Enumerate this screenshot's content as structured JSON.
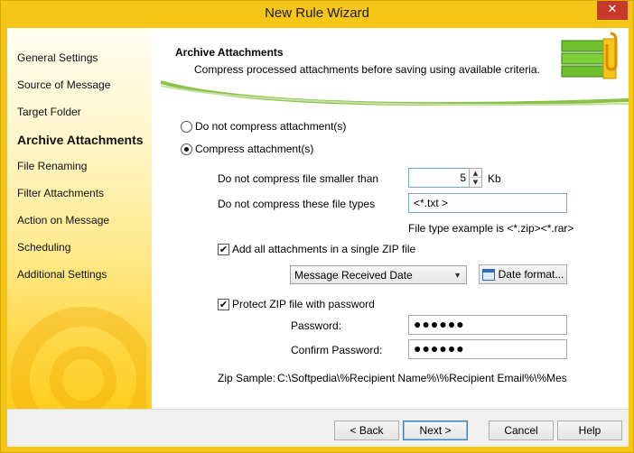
{
  "window": {
    "title": "New Rule Wizard",
    "close_glyph": "✕"
  },
  "sidebar": {
    "items": [
      {
        "label": "General Settings",
        "active": false
      },
      {
        "label": "Source of Message",
        "active": false
      },
      {
        "label": "Target Folder",
        "active": false
      },
      {
        "label": "Archive Attachments",
        "active": true
      },
      {
        "label": "File Renaming",
        "active": false
      },
      {
        "label": "Filter Attachments",
        "active": false
      },
      {
        "label": "Action on Message",
        "active": false
      },
      {
        "label": "Scheduling",
        "active": false
      },
      {
        "label": "Additional Settings",
        "active": false
      }
    ]
  },
  "header": {
    "title": "Archive Attachments",
    "subtitle": "Compress processed attachments before saving using available criteria."
  },
  "compression": {
    "option_none": "Do not compress attachment(s)",
    "option_compress": "Compress attachment(s)",
    "selected": "compress",
    "min_size_label": "Do not compress file smaller than",
    "min_size_value": "5",
    "min_size_unit": "Kb",
    "types_label": "Do not compress these file types",
    "types_value": "<*.txt >",
    "types_hint": "File type example is <*.zip><*.rar>"
  },
  "single_zip": {
    "label": "Add all attachments in a single ZIP file",
    "checked": true,
    "dropdown_value": "Message Received Date",
    "date_format_button": "Date format..."
  },
  "password": {
    "label": "Protect ZIP file with password",
    "checked": true,
    "password_label": "Password:",
    "password_value": "●●●●●●",
    "confirm_label": "Confirm Password:",
    "confirm_value": "●●●●●●"
  },
  "zip_sample": {
    "label": "Zip Sample:",
    "value": "C:\\Softpedia\\%Recipient Name%\\%Recipient Email%\\%Message S"
  },
  "footer": {
    "back": "< Back",
    "next": "Next >",
    "cancel": "Cancel",
    "help": "Help"
  },
  "colors": {
    "accent": "#f5c518",
    "link_border": "#3c7fb1",
    "swoosh_green": "#8bc34a"
  },
  "check_glyph": "✔"
}
